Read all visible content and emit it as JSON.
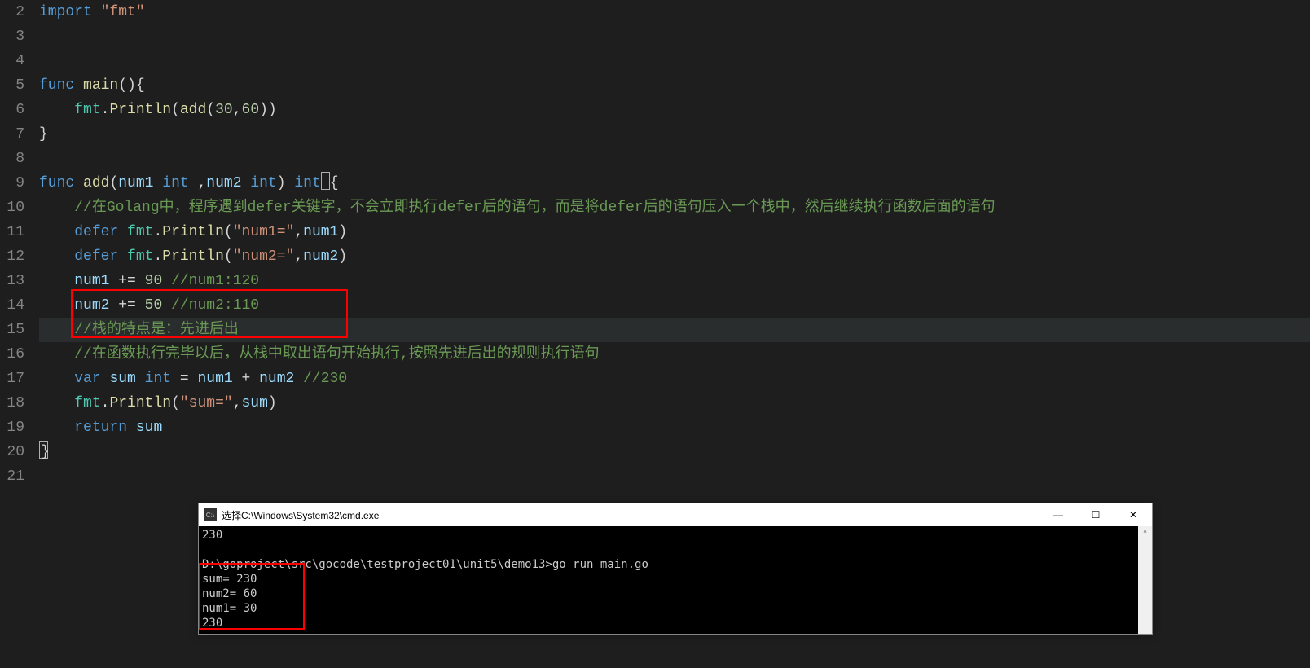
{
  "lineNumbers": [
    "2",
    "3",
    "4",
    "5",
    "6",
    "7",
    "8",
    "9",
    "10",
    "11",
    "12",
    "13",
    "14",
    "15",
    "16",
    "17",
    "18",
    "19",
    "20",
    "21"
  ],
  "code": {
    "l2_import": "import",
    "l2_fmt": "\"fmt\"",
    "l5_func": "func",
    "l5_main": "main",
    "l5_paren": "(){",
    "l6_fmt": "fmt",
    "l6_dot1": ".",
    "l6_println": "Println",
    "l6_p2": "(",
    "l6_add": "add",
    "l6_p3": "(",
    "l6_30": "30",
    "l6_comma": ",",
    "l6_60": "60",
    "l6_close": "))",
    "l7_brace": "}",
    "l9_func": "func",
    "l9_add": "add",
    "l9_p1": "(",
    "l9_num1": "num1",
    "l9_int1": "int",
    "l9_comma": " ,",
    "l9_num2": "num2",
    "l9_int2": "int",
    "l9_p2": ")",
    "l9_int3": "int",
    "l9_brace": "{",
    "l10_comment": "//在Golang中，程序遇到defer关键字，不会立即执行defer后的语句，而是将defer后的语句压入一个栈中，然后继续执行函数后面的语句",
    "l11_defer": "defer",
    "l11_fmt": "fmt",
    "l11_dot": ".",
    "l11_println": "Println",
    "l11_p1": "(",
    "l11_str": "\"num1=\"",
    "l11_comma": ",",
    "l11_num1": "num1",
    "l11_p2": ")",
    "l12_defer": "defer",
    "l12_fmt": "fmt",
    "l12_dot": ".",
    "l12_println": "Println",
    "l12_p1": "(",
    "l12_str": "\"num2=\"",
    "l12_comma": ",",
    "l12_num2": "num2",
    "l12_p2": ")",
    "l13_num1": "num1",
    "l13_op": " += ",
    "l13_90": "90",
    "l13_comment": "//num1:120",
    "l14_num2": "num2",
    "l14_op": " += ",
    "l14_50": "50",
    "l14_comment": "//num2:110",
    "l15_comment": "//栈的特点是：先进后出",
    "l16_comment": "//在函数执行完毕以后，从栈中取出语句开始执行,按照先进后出的规则执行语句",
    "l17_var": "var",
    "l17_sum": "sum",
    "l17_int": "int",
    "l17_eq": " = ",
    "l17_num1": "num1",
    "l17_plus": " + ",
    "l17_num2": "num2",
    "l17_comment": "//230",
    "l18_fmt": "fmt",
    "l18_dot": ".",
    "l18_println": "Println",
    "l18_p1": "(",
    "l18_str": "\"sum=\"",
    "l18_comma": ",",
    "l18_sum": "sum",
    "l18_p2": ")",
    "l19_return": "return",
    "l19_sum": "sum",
    "l20_brace": "}"
  },
  "terminal": {
    "title": "选择C:\\Windows\\System32\\cmd.exe",
    "iconText": "C:\\",
    "minimize": "—",
    "maximize": "☐",
    "close": "✕",
    "scrollUp": "^",
    "line1": "230",
    "line2": "",
    "line3": "D:\\goproject\\src\\gocode\\testproject01\\unit5\\demo13>go run main.go",
    "line4": "sum= 230",
    "line5": "num2= 60",
    "line6": "num1= 30",
    "line7": "230"
  }
}
